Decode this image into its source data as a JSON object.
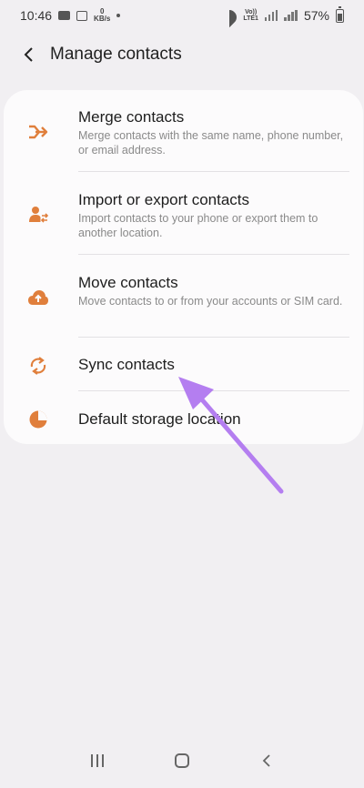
{
  "status_bar": {
    "time": "10:46",
    "kbs_value": "0",
    "kbs_unit": "KB/s",
    "volte_line1": "Vo))",
    "volte_line2": "LTE1",
    "battery": "57%"
  },
  "header": {
    "title": "Manage contacts"
  },
  "items": [
    {
      "title": "Merge contacts",
      "subtitle": "Merge contacts with the same name, phone number, or email address.",
      "icon": "merge-icon"
    },
    {
      "title": "Import or export contacts",
      "subtitle": "Import contacts to your phone or export them to another location.",
      "icon": "import-export-icon"
    },
    {
      "title": "Move contacts",
      "subtitle": "Move contacts to or from your accounts or SIM card.",
      "icon": "cloud-upload-icon"
    },
    {
      "title": "Sync contacts",
      "subtitle": "",
      "icon": "sync-icon"
    },
    {
      "title": "Default storage location",
      "subtitle": "",
      "icon": "pie-chart-icon"
    }
  ],
  "colors": {
    "accent": "#e07f3c",
    "annotation_arrow": "#b47ef0",
    "background": "#f1eff2",
    "card": "#fcfbfc"
  }
}
